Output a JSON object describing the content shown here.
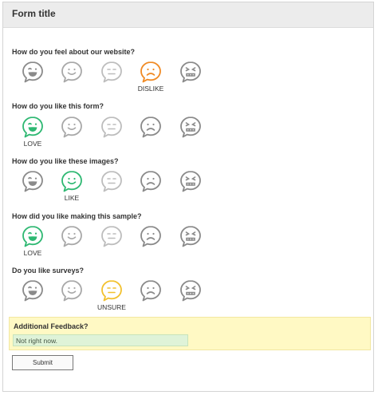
{
  "form": {
    "title": "Form title",
    "submit_label": "Submit"
  },
  "questions": [
    {
      "label": "How do you feel about our website?",
      "selected": 3,
      "caption": "DISLIKE",
      "selected_color": "#f08a24"
    },
    {
      "label": "How do you like this form?",
      "selected": 0,
      "caption": "LOVE",
      "selected_color": "#2eb872"
    },
    {
      "label": "How do you like these images?",
      "selected": 1,
      "caption": "LIKE",
      "selected_color": "#2eb872"
    },
    {
      "label": "How did you like making this sample?",
      "selected": 0,
      "caption": "LOVE",
      "selected_color": "#2eb872"
    },
    {
      "label": "Do you like surveys?",
      "selected": 2,
      "caption": "UNSURE",
      "selected_color": "#f2c12e"
    }
  ],
  "faces": [
    "love-face-icon",
    "like-face-icon",
    "unsure-face-icon",
    "dislike-face-icon",
    "hate-face-icon"
  ],
  "colors": {
    "unselected_strong": "#8a8a8a",
    "unselected_light": "#bdbdbd",
    "love": "#2eb872",
    "dislike": "#f08a24",
    "unsure": "#f2c12e"
  },
  "feedback": {
    "label": "Additional Feedback?",
    "value": "Not right now."
  }
}
